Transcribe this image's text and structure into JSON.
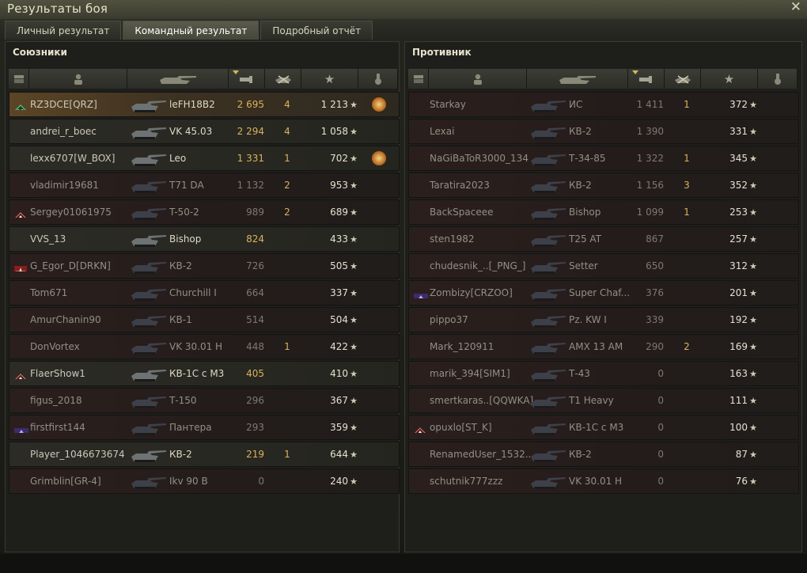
{
  "window": {
    "title": "Результаты боя"
  },
  "tabs": [
    {
      "label": "Личный результат",
      "active": false
    },
    {
      "label": "Командный результат",
      "active": true
    },
    {
      "label": "Подробный отчёт",
      "active": false
    }
  ],
  "allies": {
    "title": "Союзники",
    "rows": [
      {
        "player": "RZ3DCE[QRZ]",
        "tank": "leFH18B2",
        "damage": "2 695",
        "kills": "4",
        "xp": "1 213",
        "state": "me",
        "dmgClass": "hi",
        "badge": "rank-13",
        "medal": true
      },
      {
        "player": "andrei_r_boec",
        "tank": "VK 45.03",
        "damage": "2 294",
        "kills": "4",
        "xp": "1 058",
        "state": "alive",
        "dmgClass": "hi",
        "badge": "",
        "medal": false
      },
      {
        "player": "lexx6707[W_BOX]",
        "tank": "Leo",
        "damage": "1 331",
        "kills": "1",
        "xp": "702",
        "state": "alive",
        "dmgClass": "hi",
        "badge": "",
        "medal": true
      },
      {
        "player": "vladimir19681",
        "tank": "T71 DA",
        "damage": "1 132",
        "kills": "2",
        "xp": "953",
        "state": "dead",
        "dmgClass": "lo",
        "badge": "",
        "medal": false
      },
      {
        "player": "Sergey01061975",
        "tank": "T-50-2",
        "damage": "989",
        "kills": "2",
        "xp": "689",
        "state": "dead",
        "dmgClass": "lo",
        "badge": "diamond",
        "medal": false
      },
      {
        "player": "VVS_13",
        "tank": "Bishop",
        "damage": "824",
        "kills": "",
        "xp": "433",
        "state": "alive",
        "dmgClass": "hi",
        "badge": "",
        "medal": false
      },
      {
        "player": "G_Egor_D[DRKN]",
        "tank": "КВ-2",
        "damage": "726",
        "kills": "",
        "xp": "505",
        "state": "dead",
        "dmgClass": "lo",
        "badge": "star-red",
        "medal": false
      },
      {
        "player": "Tom671",
        "tank": "Churchill I",
        "damage": "664",
        "kills": "",
        "xp": "337",
        "state": "dead",
        "dmgClass": "lo",
        "badge": "",
        "medal": false
      },
      {
        "player": "AmurChanin90",
        "tank": "КВ-1",
        "damage": "514",
        "kills": "",
        "xp": "504",
        "state": "dead",
        "dmgClass": "lo",
        "badge": "",
        "medal": false
      },
      {
        "player": "DonVortex",
        "tank": "VK 30.01 H",
        "damage": "448",
        "kills": "1",
        "xp": "422",
        "state": "dead",
        "dmgClass": "lo",
        "badge": "",
        "medal": false
      },
      {
        "player": "FlaerShow1",
        "tank": "КВ-1С с М3",
        "damage": "405",
        "kills": "",
        "xp": "410",
        "state": "alive",
        "dmgClass": "hi",
        "badge": "diamond",
        "medal": false
      },
      {
        "player": "figus_2018",
        "tank": "Т-150",
        "damage": "296",
        "kills": "",
        "xp": "367",
        "state": "dead",
        "dmgClass": "lo",
        "badge": "",
        "medal": false
      },
      {
        "player": "firstfirst144",
        "tank": "Пантера",
        "damage": "293",
        "kills": "",
        "xp": "359",
        "state": "dead",
        "dmgClass": "lo",
        "badge": "clan-purple",
        "medal": false
      },
      {
        "player": "Player_1046673674",
        "tank": "КВ-2",
        "damage": "219",
        "kills": "1",
        "xp": "644",
        "state": "alive",
        "dmgClass": "hi",
        "badge": "",
        "medal": false
      },
      {
        "player": "Grimblin[GR-4]",
        "tank": "Ikv 90 B",
        "damage": "0",
        "kills": "",
        "xp": "240",
        "state": "dead",
        "dmgClass": "lo",
        "badge": "",
        "medal": false
      }
    ]
  },
  "enemies": {
    "title": "Противник",
    "rows": [
      {
        "player": "Starkay",
        "tank": "ИС",
        "damage": "1 411",
        "kills": "1",
        "xp": "372",
        "state": "dead",
        "dmgClass": "lo",
        "badge": "",
        "medal": false
      },
      {
        "player": "Lexai",
        "tank": "КВ-2",
        "damage": "1 390",
        "kills": "",
        "xp": "331",
        "state": "dead",
        "dmgClass": "lo",
        "badge": "",
        "medal": false
      },
      {
        "player": "NaGiBaToR3000_134",
        "tank": "Т-34-85",
        "damage": "1 322",
        "kills": "1",
        "xp": "345",
        "state": "dead",
        "dmgClass": "lo",
        "badge": "",
        "medal": false
      },
      {
        "player": "Taratira2023",
        "tank": "КВ-2",
        "damage": "1 156",
        "kills": "3",
        "xp": "352",
        "state": "dead",
        "dmgClass": "lo",
        "badge": "",
        "medal": false
      },
      {
        "player": "BackSpaceee",
        "tank": "Bishop",
        "damage": "1 099",
        "kills": "1",
        "xp": "253",
        "state": "dead",
        "dmgClass": "lo",
        "badge": "",
        "medal": false
      },
      {
        "player": "sten1982",
        "tank": "T25 AT",
        "damage": "867",
        "kills": "",
        "xp": "257",
        "state": "dead",
        "dmgClass": "lo",
        "badge": "",
        "medal": false
      },
      {
        "player": "chudesnik_..[_PNG_]",
        "tank": "Setter",
        "damage": "650",
        "kills": "",
        "xp": "312",
        "state": "dead",
        "dmgClass": "lo",
        "badge": "",
        "medal": false
      },
      {
        "player": "Zombizy[CRZOO]",
        "tank": "Super Chaf...",
        "damage": "376",
        "kills": "",
        "xp": "201",
        "state": "dead",
        "dmgClass": "lo",
        "badge": "clan-purple",
        "medal": false
      },
      {
        "player": "pippo37",
        "tank": "Pz. KW I",
        "damage": "339",
        "kills": "",
        "xp": "192",
        "state": "dead",
        "dmgClass": "lo",
        "badge": "",
        "medal": false
      },
      {
        "player": "Mark_120911",
        "tank": "AMX 13 AM",
        "damage": "290",
        "kills": "2",
        "xp": "169",
        "state": "dead",
        "dmgClass": "lo",
        "badge": "",
        "medal": false
      },
      {
        "player": "marik_394[SIM1]",
        "tank": "Т-43",
        "damage": "0",
        "kills": "",
        "xp": "163",
        "state": "dead",
        "dmgClass": "lo",
        "badge": "",
        "medal": false
      },
      {
        "player": "smertkaras..[QQWKA]",
        "tank": "T1 Heavy",
        "damage": "0",
        "kills": "",
        "xp": "111",
        "state": "dead",
        "dmgClass": "lo",
        "badge": "",
        "medal": false
      },
      {
        "player": "opuxlo[ST_K]",
        "tank": "КВ-1С с М3",
        "damage": "0",
        "kills": "",
        "xp": "100",
        "state": "dead",
        "dmgClass": "lo",
        "badge": "diamond",
        "medal": false
      },
      {
        "player": "RenamedUser_1532..",
        "tank": "КВ-2",
        "damage": "0",
        "kills": "",
        "xp": "87",
        "state": "dead",
        "dmgClass": "lo",
        "badge": "",
        "medal": false
      },
      {
        "player": "schutnik777zzz",
        "tank": "VK 30.01 H",
        "damage": "0",
        "kills": "",
        "xp": "76",
        "state": "dead",
        "dmgClass": "lo",
        "badge": "",
        "medal": false
      }
    ]
  },
  "columns": [
    "squad-icon",
    "player-icon",
    "tank-icon",
    "damage-icon",
    "kills-icon",
    "xp-icon",
    "medal-icon"
  ],
  "colors": {
    "accent": "#d9b35c",
    "me_row": "#5c4526",
    "dead_row": "#2b1f1d"
  }
}
